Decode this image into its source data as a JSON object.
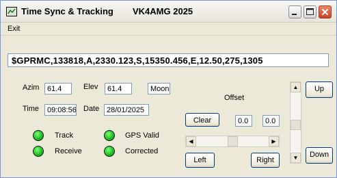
{
  "window": {
    "title": "Time Sync  & Tracking",
    "callsign": "VK4AMG 2025"
  },
  "menu": {
    "exit": "Exit"
  },
  "gps": {
    "sentence": "$GPRMC,133818,A,2330.123,S,15350.456,E,12.50,275,1305"
  },
  "fields": {
    "azim_label": "Azim",
    "azim_value": "61.4",
    "elev_label": "Elev",
    "elev_value": "61.4",
    "target": "Moon",
    "time_label": "Time",
    "time_value": "09:08:56",
    "date_label": "Date",
    "date_value": "28/01/2025"
  },
  "indicators": [
    {
      "label": "Track",
      "color": "#21c021"
    },
    {
      "label": "Receive",
      "color": "#21c021"
    },
    {
      "label": "GPS Valid",
      "color": "#21c021"
    },
    {
      "label": "Corrected",
      "color": "#21c021"
    }
  ],
  "offset": {
    "label": "Offset",
    "clear": "Clear",
    "value1": "0.0",
    "value2": "0.0",
    "slider_position": 0.5,
    "left": "Left",
    "right": "Right"
  },
  "vertical": {
    "up": "Up",
    "down": "Down",
    "slider_position": 0.55
  }
}
